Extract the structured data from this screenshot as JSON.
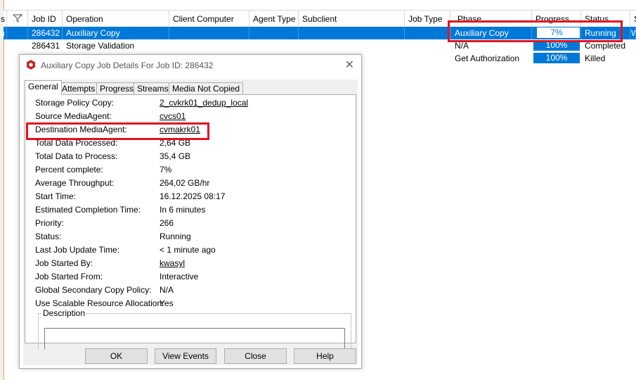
{
  "grid": {
    "headers": [
      "s",
      "",
      "Job ID",
      "Operation",
      "Client Computer",
      "Agent Type",
      "Subclient",
      "Job Type",
      "Phase",
      "Progress",
      "Status",
      "S"
    ],
    "rows": [
      {
        "prefix": "n",
        "job_id": "286432",
        "operation": "Auxiliary Copy",
        "phase": "Auxiliary Copy",
        "progress": "7%",
        "progress_value": 7,
        "status": "Running",
        "extra": "W"
      },
      {
        "job_id": "286431",
        "operation": "Storage Validation",
        "phase": "N/A",
        "progress": "100%",
        "status": "Completed"
      },
      {
        "phase": "Get Authorization",
        "progress": "100%",
        "status": "Killed"
      }
    ]
  },
  "dialog": {
    "title": "Auxiliary Copy Job Details For Job ID: 286432",
    "tabs": [
      "General",
      "Attempts",
      "Progress",
      "Streams",
      "Media Not Copied"
    ],
    "fields": [
      {
        "label": "Storage Policy Copy:",
        "value": "2_cvkrk01_dedup_local"
      },
      {
        "label": "Source MediaAgent:",
        "value": "cvcs01"
      },
      {
        "label": "Destination MediaAgent:",
        "value": "cvmakrk01"
      },
      {
        "label": "Total Data Processed:",
        "value": "2,64 GB"
      },
      {
        "label": "Total Data to Process:",
        "value": "35,4 GB"
      },
      {
        "label": "Percent complete:",
        "value": "7%"
      },
      {
        "label": "Average Throughput:",
        "value": "264,02 GB/hr"
      },
      {
        "label": "Start Time:",
        "value": "16.12.2025 08:17"
      },
      {
        "label": "Estimated Completion Time:",
        "value": "In 6 minutes"
      },
      {
        "label": "Priority:",
        "value": "266"
      },
      {
        "label": "Status:",
        "value": "Running"
      },
      {
        "label": "Last Job Update Time:",
        "value": "< 1 minute ago"
      },
      {
        "label": "Job Started By:",
        "value": "kwasyl"
      },
      {
        "label": "Job Started From:",
        "value": "Interactive"
      },
      {
        "label": "Global Secondary Copy Policy:",
        "value": "N/A"
      },
      {
        "label": "Use Scalable Resource Allocation:",
        "value": "Yes"
      }
    ],
    "description_label": "Description",
    "buttons": {
      "ok": "OK",
      "view_events": "View Events",
      "close": "Close",
      "help": "Help"
    }
  },
  "colors": {
    "selection": "#0078d7",
    "highlight_box": "#e0141e",
    "brand_icon": "#c4262e"
  }
}
